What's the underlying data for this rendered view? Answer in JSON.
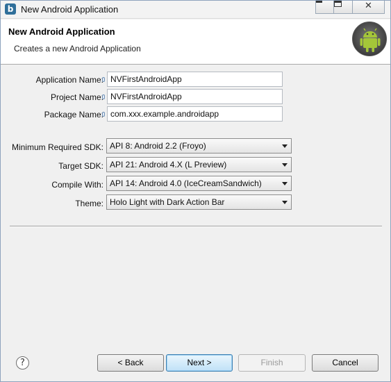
{
  "window": {
    "title": "New Android Application",
    "icon": "eclipse-b-icon"
  },
  "banner": {
    "title": "New Android Application",
    "subtitle": "Creates a new Android Application",
    "logo": "android-logo-icon"
  },
  "form": {
    "application_name": {
      "label": "Application Name:",
      "value": "NVFirstAndroidApp"
    },
    "project_name": {
      "label": "Project Name:",
      "value": "NVFirstAndroidApp"
    },
    "package_name": {
      "label": "Package Name:",
      "value": "com.xxx.example.androidapp"
    },
    "min_sdk": {
      "label": "Minimum Required SDK:",
      "value": "API 8: Android 2.2 (Froyo)"
    },
    "target_sdk": {
      "label": "Target SDK:",
      "value": "API 21: Android 4.X (L Preview)"
    },
    "compile_with": {
      "label": "Compile With:",
      "value": "API 14: Android 4.0 (IceCreamSandwich)"
    },
    "theme": {
      "label": "Theme:",
      "value": "Holo Light with Dark Action Bar"
    }
  },
  "footer": {
    "help": "?",
    "back_label": "< Back",
    "next_label": "Next >",
    "finish_label": "Finish",
    "cancel_label": "Cancel"
  },
  "colors": {
    "window_bg": "#f0f0f0",
    "primary_button": "#bfe1f7",
    "android_green": "#a4c639"
  }
}
